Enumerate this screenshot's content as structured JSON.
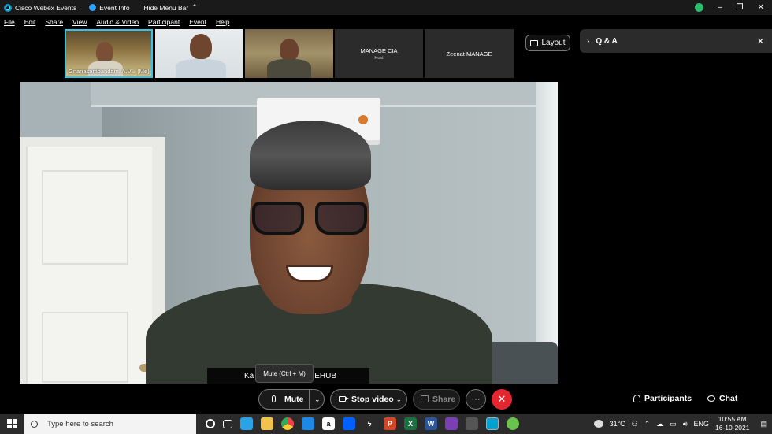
{
  "titlebar": {
    "app_title": "Cisco Webex Events",
    "event_info": "Event Info",
    "hide_menu": "Hide Menu Bar",
    "minimize": "‒",
    "restore": "❐",
    "close": "✕"
  },
  "menu": [
    "File",
    "Edit",
    "Share",
    "View",
    "Audio & Video",
    "Participant",
    "Event",
    "Help"
  ],
  "thumbnails": {
    "me_name": "Gnanasambandam. A.V...",
    "me_tag": "(Me)",
    "host_name": "MANAGE CIA",
    "host_role": "Host",
    "fifth_name": "Zeenat MANAGE"
  },
  "layout_label": "Layout",
  "qa": {
    "title": "Q & A",
    "close": "✕"
  },
  "speaker": {
    "name_left": "Ka",
    "name_right": "EHUB"
  },
  "tooltip": "Mute (Ctrl + M)",
  "controls": {
    "mute": "Mute",
    "stop_video": "Stop video",
    "share": "Share",
    "more": "···",
    "end": "✕",
    "participants": "Participants",
    "chat": "Chat"
  },
  "taskbar": {
    "search_placeholder": "Type here to search",
    "weather": "31°C",
    "lang": "ENG",
    "time": "10:55 AM",
    "date": "16-10-2021"
  },
  "colors": {
    "accent_cyan": "#34c6e8",
    "end_red": "#e3262f",
    "status_green": "#2bbd6e"
  }
}
